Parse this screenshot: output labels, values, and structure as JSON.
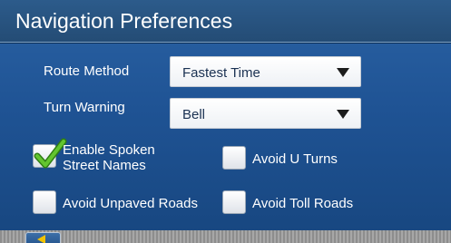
{
  "title": "Navigation Preferences",
  "route_method": {
    "label": "Route Method",
    "value": "Fastest Time"
  },
  "turn_warning": {
    "label": "Turn Warning",
    "value": "Bell"
  },
  "options": {
    "spoken_street_names": {
      "label_line1": "Enable Spoken",
      "label_line2": "Street Names",
      "checked": true
    },
    "avoid_u_turns": {
      "label": "Avoid U Turns",
      "checked": false
    },
    "avoid_unpaved_roads": {
      "label": "Avoid Unpaved Roads",
      "checked": false
    },
    "avoid_toll_roads": {
      "label": "Avoid Toll Roads",
      "checked": false
    }
  },
  "colors": {
    "background": "#1f5394",
    "title_bar": "#2c5b8b",
    "checkmark": "#4caf23",
    "back_arrow": "#f2c200"
  },
  "icons": {
    "checkmark": "checkmark-icon",
    "dropdown": "chevron-down-icon",
    "back": "back-arrow-icon"
  }
}
